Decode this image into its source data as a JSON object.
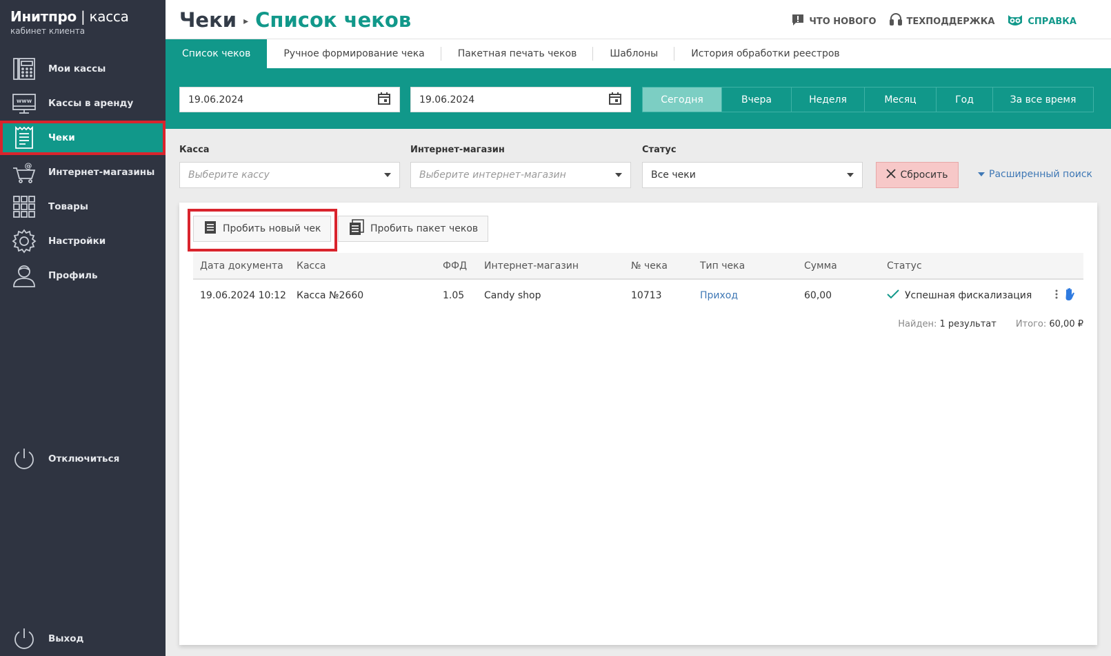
{
  "sidebar": {
    "brand_main": "Инитпро",
    "brand_sep": " | ",
    "brand_thin": "касса",
    "brand_sub": "кабинет клиента",
    "items": [
      {
        "label": "Мои кассы",
        "icon": "cash-register-icon"
      },
      {
        "label": "Кассы в аренду",
        "icon": "www-monitor-icon"
      },
      {
        "label": "Чеки",
        "icon": "receipt-icon",
        "active": true
      },
      {
        "label": "Интернет-магазины",
        "icon": "cart-icon"
      },
      {
        "label": "Товары",
        "icon": "grid-icon"
      },
      {
        "label": "Настройки",
        "icon": "gear-icon"
      },
      {
        "label": "Профиль",
        "icon": "user-icon"
      }
    ],
    "disconnect_label": "Отключиться",
    "logout_label": "Выход"
  },
  "header": {
    "crumb_root": "Чеки",
    "crumb_current": "Список чеков",
    "whats_new": "ЧТО НОВОГО",
    "support": "ТЕХПОДДЕРЖКА",
    "help": "СПРАВКА"
  },
  "tabs": [
    {
      "label": "Список чеков",
      "active": true
    },
    {
      "label": "Ручное формирование чека"
    },
    {
      "label": "Пакетная печать чеков"
    },
    {
      "label": "Шаблоны"
    },
    {
      "label": "История обработки реестров"
    }
  ],
  "dates": {
    "from": "19.06.2024",
    "to": "19.06.2024"
  },
  "periods": [
    {
      "label": "Сегодня",
      "active": true
    },
    {
      "label": "Вчера"
    },
    {
      "label": "Неделя"
    },
    {
      "label": "Месяц"
    },
    {
      "label": "Год"
    },
    {
      "label": "За все время"
    }
  ],
  "filters": {
    "kassa_label": "Касса",
    "kassa_placeholder": "Выберите кассу",
    "shop_label": "Интернет-магазин",
    "shop_placeholder": "Выберите интернет-магазин",
    "status_label": "Статус",
    "status_value": "Все чеки",
    "reset_label": "Сбросить",
    "advanced_label": "Расширенный поиск"
  },
  "actions": {
    "new_check": "Пробить новый чек",
    "batch_check": "Пробить пакет чеков"
  },
  "table": {
    "headers": [
      "Дата документа",
      "Касса",
      "ФФД",
      "Интернет-магазин",
      "№ чека",
      "Тип чека",
      "Сумма",
      "Статус"
    ],
    "rows": [
      {
        "date": "19.06.2024 10:12",
        "kassa": "Касса №2660",
        "ffd": "1.05",
        "shop": "Candy shop",
        "number": "10713",
        "type": "Приход",
        "sum": "60,00",
        "status": "Успешная фискализация"
      }
    ]
  },
  "summary": {
    "found_label": "Найден:",
    "found_value": "1 результат",
    "total_label": "Итого:",
    "total_value": "60,00 ₽"
  },
  "colors": {
    "teal": "#11988a",
    "sidebar": "#2f3441",
    "highlight": "#d9242d",
    "link": "#3f78b5"
  }
}
